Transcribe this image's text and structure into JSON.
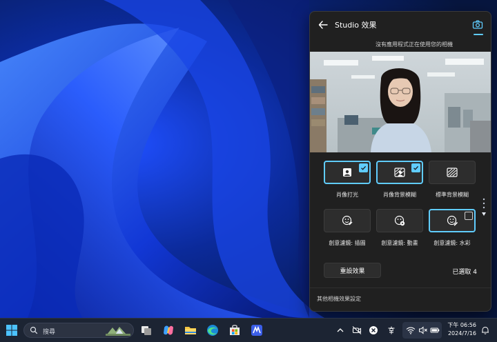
{
  "panel": {
    "title": "Studio 效果",
    "status": "沒有應用程式正在使用您的相機",
    "effects": [
      {
        "label": "肖像打光",
        "icon": "portrait-light-icon",
        "selected": true
      },
      {
        "label": "肖像背景模糊",
        "icon": "portrait-blur-icon",
        "selected": true
      },
      {
        "label": "標準背景模糊",
        "icon": "standard-blur-icon",
        "selected": false
      },
      {
        "label": "創意濾鏡: 插圖",
        "icon": "illustration-filter-icon",
        "selected": false
      },
      {
        "label": "創意濾鏡: 動畫",
        "icon": "animation-filter-icon",
        "selected": false
      },
      {
        "label": "創意濾鏡: 水彩",
        "icon": "watercolor-filter-icon",
        "selected": true
      }
    ],
    "reset_label": "重設效果",
    "selected_count": "已選取 4",
    "footer_label": "其他相機效果設定"
  },
  "taskbar": {
    "search_placeholder": "搜尋",
    "clock_time": "下午 06:56",
    "clock_date": "2024/7/16"
  },
  "colors": {
    "accent": "#60cdff",
    "panel_bg": "#202020",
    "taskbar_bg": "#1c2433"
  }
}
